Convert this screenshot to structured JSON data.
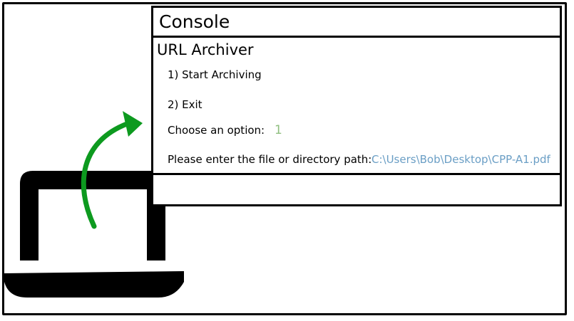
{
  "console": {
    "title": "Console",
    "app_title": "URL Archiver",
    "menu": [
      "1) Start Archiving",
      "2) Exit"
    ],
    "option_prompt": "Choose an option:",
    "option_input": "1",
    "path_prompt": "Please enter the file or directory path:",
    "path_input": "C:\\Users\\Bob\\Desktop\\CPP-A1.pdf"
  },
  "colors": {
    "line": "#000000",
    "arrow": "#0d9a1f",
    "option_input": "#8fbf7f",
    "path_input": "#6a9ec5"
  },
  "icons": {
    "laptop": "laptop-icon",
    "arrow": "curved-arrow-icon"
  }
}
